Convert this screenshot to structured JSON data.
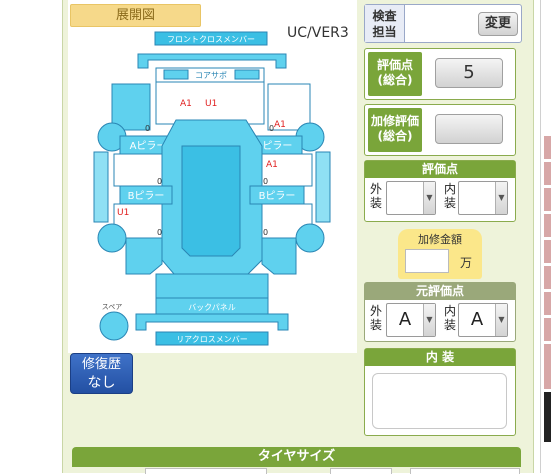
{
  "diagram": {
    "title": "展開図",
    "version": "UC/VER3",
    "labels": {
      "front_cross": "フロントクロスメンバー",
      "core_support": "コアサポ",
      "a_pillar_left": "Aピラー",
      "a_pillar_right": "Aピラー",
      "b_pillar_left": "Bピラー",
      "b_pillar_right": "Bピラー",
      "back_panel": "バックパネル",
      "rear_cross": "リアクロスメンバー",
      "spare": "スペア"
    },
    "damage_marks": [
      {
        "id": "front-a1",
        "text": "A1"
      },
      {
        "id": "front-u1",
        "text": "U1"
      },
      {
        "id": "right-front-a1",
        "text": "A1"
      },
      {
        "id": "right-door-a1",
        "text": "A1"
      },
      {
        "id": "left-rear-u1",
        "text": "U1"
      }
    ],
    "zero_marks": [
      "0",
      "0",
      "0",
      "0",
      "0",
      "0"
    ]
  },
  "history_button": {
    "line1": "修復歴",
    "line2": "なし"
  },
  "inspector": {
    "label": "検査\n担当",
    "button": "変更"
  },
  "total_score": {
    "label": "評価点\n(総合)",
    "value": "5"
  },
  "repair_score": {
    "label": "加修評価\n(総合)",
    "value": ""
  },
  "grade": {
    "title": "評価点",
    "exterior_label": "外\n装",
    "exterior_value": "",
    "interior_label": "内\n装",
    "interior_value": ""
  },
  "repair_cost": {
    "label": "加修金額",
    "value": "",
    "unit": "万"
  },
  "original_grade": {
    "title": "元評価点",
    "exterior_label": "外\n装",
    "exterior_value": "A",
    "interior_label": "内\n装",
    "interior_value": "A"
  },
  "interior_notes": {
    "title": "内 装",
    "value": ""
  },
  "tire_size": {
    "title": "タイヤサイズ"
  },
  "colors": {
    "green": "#7aa53a",
    "gray_green": "#9aa87a",
    "car_blue": "#5fd1ee",
    "history_blue": "#2350a3"
  }
}
